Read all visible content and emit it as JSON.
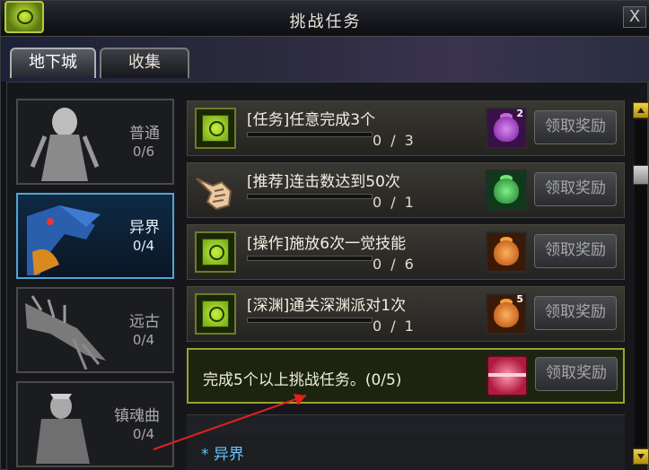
{
  "window": {
    "title": "挑战任务",
    "close_label": "X"
  },
  "tabs": [
    {
      "label": "地下城",
      "active": true
    },
    {
      "label": "收集",
      "active": false
    }
  ],
  "dungeons": [
    {
      "name": "普通",
      "count": "0/6"
    },
    {
      "name": "异界",
      "count": "0/4",
      "selected": true
    },
    {
      "name": "远古",
      "count": "0/4"
    },
    {
      "name": "镇魂曲",
      "count": "0/4"
    }
  ],
  "quests": [
    {
      "title": "[任务]任意完成3个",
      "current": "0",
      "total": "3",
      "reward_color": "#9b2fb8",
      "reward_qty": "2",
      "claim": "领取奖励",
      "icon": "quest-scroll-icon"
    },
    {
      "title": "[推荐]连击数达到50次",
      "current": "0",
      "total": "1",
      "reward_color": "#2f9a3a",
      "reward_qty": "",
      "claim": "领取奖励",
      "icon": "pointing-hand-icon"
    },
    {
      "title": "[操作]施放6次一觉技能",
      "current": "0",
      "total": "6",
      "reward_color": "#d9650f",
      "reward_qty": "",
      "claim": "领取奖励",
      "icon": "quest-scroll-icon"
    },
    {
      "title": "[深渊]通关深渊派对1次",
      "current": "0",
      "total": "1",
      "reward_color": "#d9650f",
      "reward_qty": "5",
      "claim": "领取奖励",
      "icon": "quest-scroll-icon"
    }
  ],
  "summary": {
    "text": "完成5个以上挑战任务。(0/5)",
    "claim": "领取奖励"
  },
  "dungeon_label": "* 异界",
  "colors": {
    "selected_border": "#4fa6d6",
    "summary_border": "#9aa230",
    "label_blue": "#5fc6ff",
    "annotation_arrow": "#e02020"
  }
}
